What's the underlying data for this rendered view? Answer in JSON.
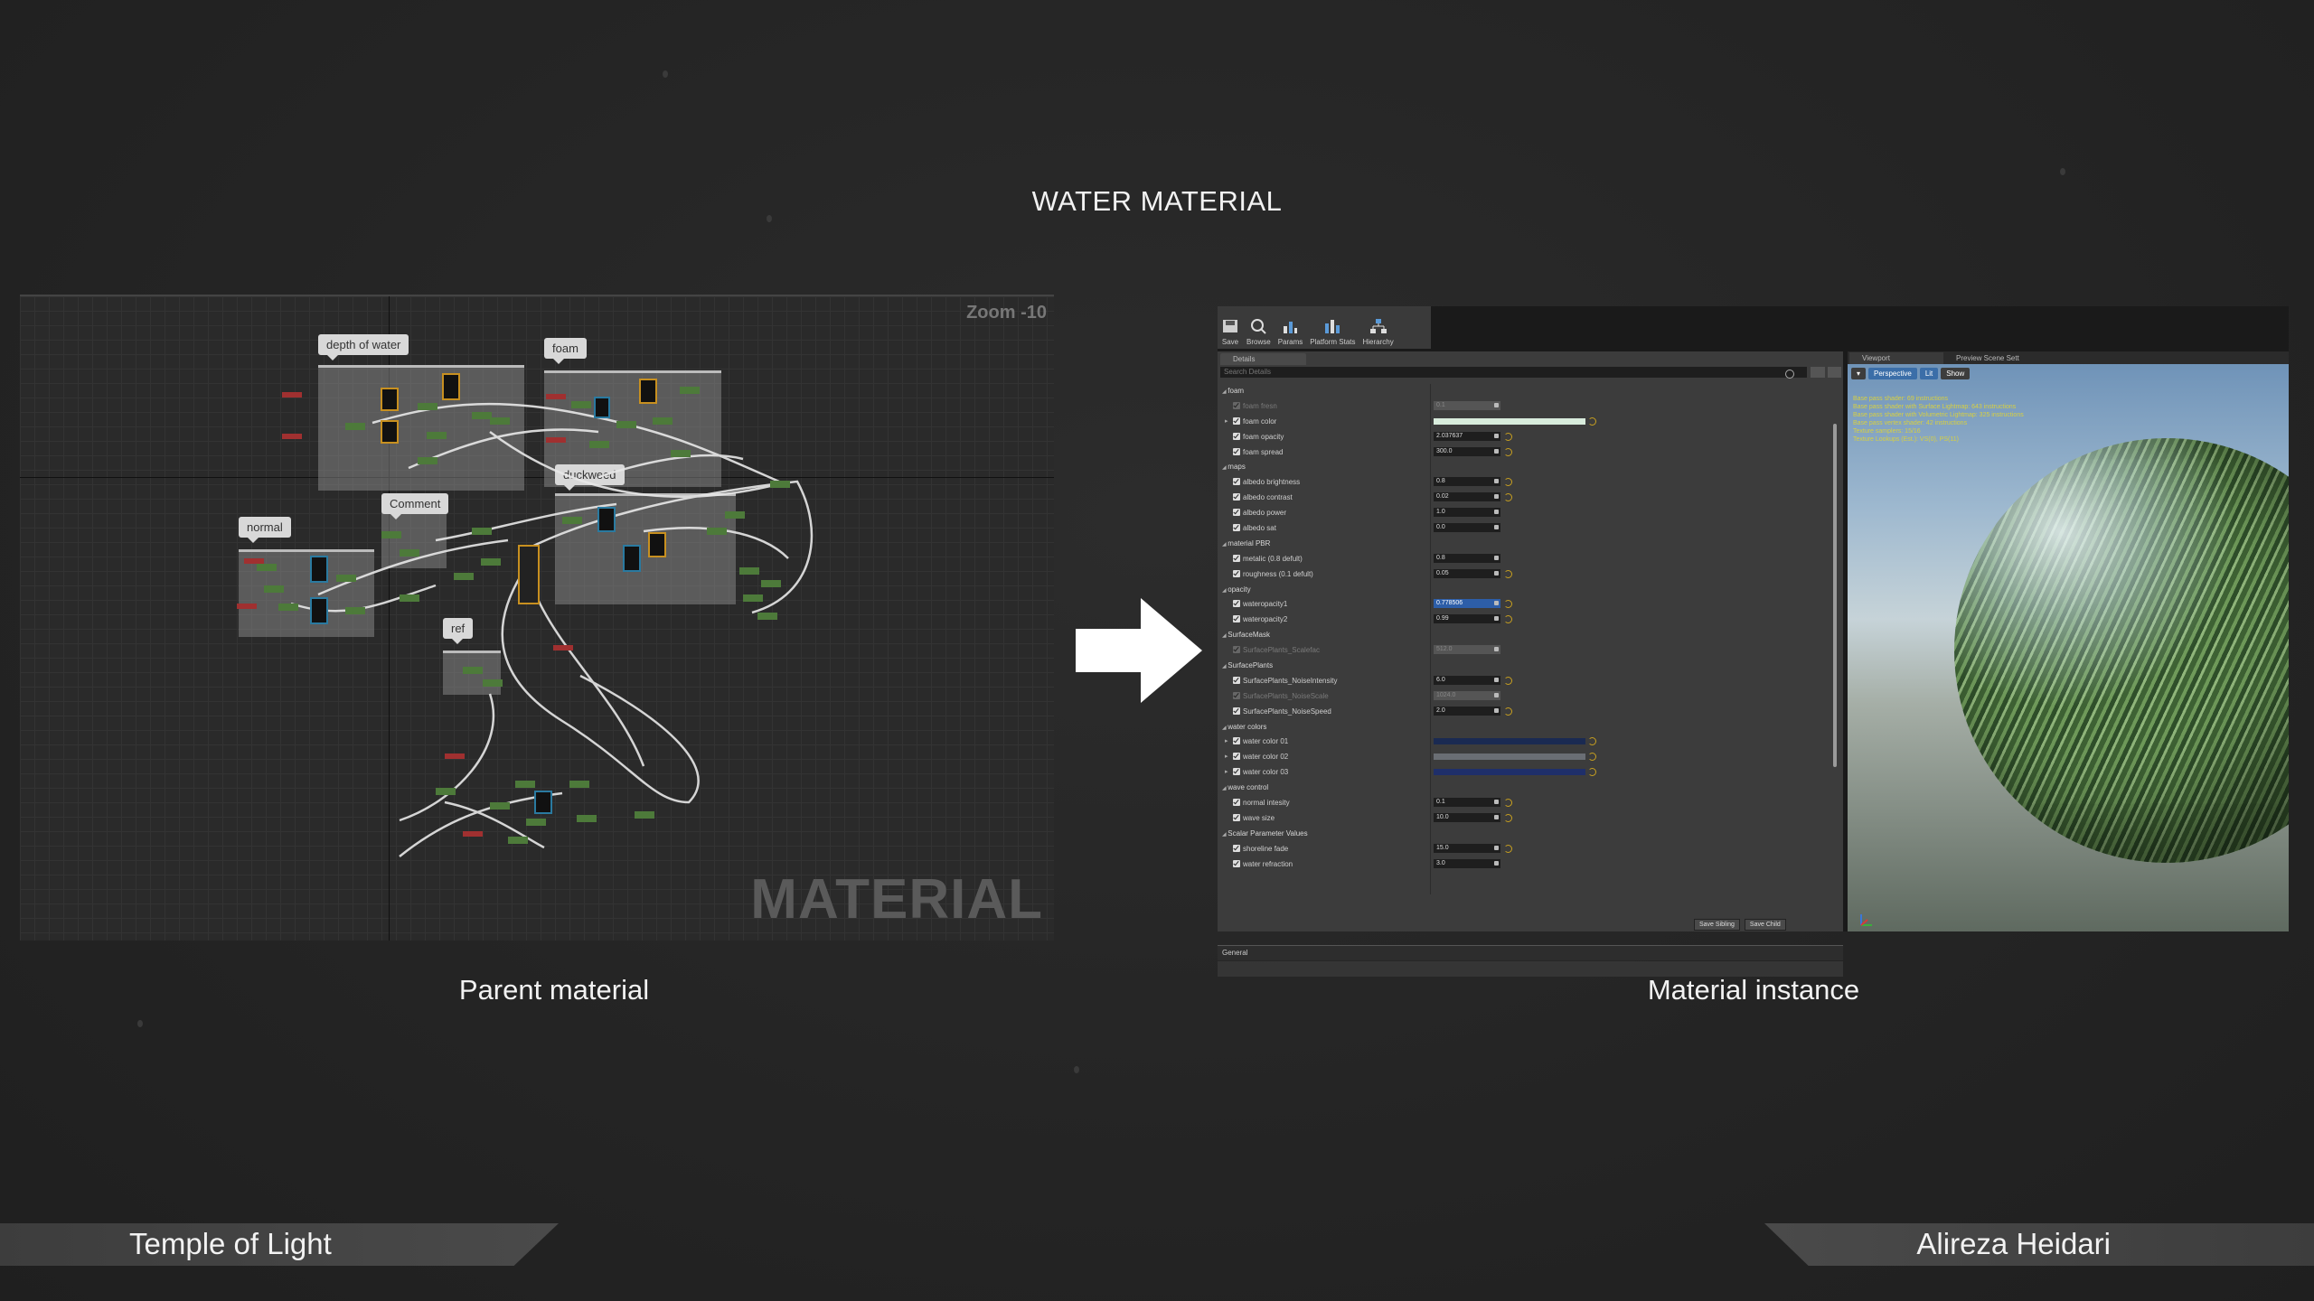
{
  "page": {
    "title": "WATER MATERIAL",
    "left_caption": "Parent material",
    "right_caption": "Material instance",
    "footer_left": "Temple of Light",
    "footer_right": "Alireza Heidari"
  },
  "graph": {
    "zoom": "Zoom -10",
    "watermark": "MATERIAL",
    "comments": [
      "depth of water",
      "foam",
      "duckweed",
      "Comment",
      "normal",
      "ref"
    ]
  },
  "editor": {
    "toolbar": [
      "Save",
      "Browse",
      "Params",
      "Platform Stats",
      "Hierarchy"
    ],
    "details_tab": "Details",
    "search_placeholder": "Search Details",
    "rows": [
      {
        "type": "cat",
        "name": "foam"
      },
      {
        "type": "param",
        "name": "foam fresn",
        "value": "0.1",
        "enabled": false
      },
      {
        "type": "param",
        "name": "foam color",
        "bar": "#d8ecdc",
        "expand": true,
        "enabled": true
      },
      {
        "type": "param",
        "name": "foam opacity",
        "value": "2.037637",
        "enabled": true,
        "reset": true
      },
      {
        "type": "param",
        "name": "foam spread",
        "value": "300.0",
        "enabled": true,
        "reset": true
      },
      {
        "type": "cat",
        "name": "maps"
      },
      {
        "type": "param",
        "name": "albedo brightness",
        "value": "0.8",
        "enabled": true,
        "reset": true
      },
      {
        "type": "param",
        "name": "albedo contrast",
        "value": "0.02",
        "enabled": true,
        "reset": true
      },
      {
        "type": "param",
        "name": "albedo power",
        "value": "1.0",
        "enabled": true
      },
      {
        "type": "param",
        "name": "albedo sat",
        "value": "0.0",
        "enabled": true
      },
      {
        "type": "cat",
        "name": "material PBR"
      },
      {
        "type": "param",
        "name": "metalic (0.8 defult)",
        "value": "0.8",
        "enabled": true
      },
      {
        "type": "param",
        "name": "roughness (0.1 defult)",
        "value": "0.05",
        "enabled": true,
        "reset": true
      },
      {
        "type": "cat",
        "name": "opacity"
      },
      {
        "type": "param",
        "name": "wateropacity1",
        "value": "0.778506",
        "enabled": true,
        "reset": true,
        "selected": true
      },
      {
        "type": "param",
        "name": "wateropacity2",
        "value": "0.99",
        "enabled": true,
        "reset": true
      },
      {
        "type": "cat",
        "name": "SurfaceMask"
      },
      {
        "type": "param",
        "name": "SurfacePlants_Scalefac",
        "value": "512.0",
        "enabled": false
      },
      {
        "type": "cat",
        "name": "SurfacePlants"
      },
      {
        "type": "param",
        "name": "SurfacePlants_NoiseIntensity",
        "value": "6.0",
        "enabled": true,
        "reset": true
      },
      {
        "type": "param",
        "name": "SurfacePlants_NoiseScale",
        "value": "1024.0",
        "enabled": false
      },
      {
        "type": "param",
        "name": "SurfacePlants_NoiseSpeed",
        "value": "2.0",
        "enabled": true,
        "reset": true
      },
      {
        "type": "cat",
        "name": "water colors"
      },
      {
        "type": "param",
        "name": "water color 01",
        "bar": "#1a2a52",
        "expand": true,
        "enabled": true
      },
      {
        "type": "param",
        "name": "water color 02",
        "bar": "#6a6e74",
        "expand": true,
        "enabled": true
      },
      {
        "type": "param",
        "name": "water color 03",
        "bar": "#1f2f6a",
        "expand": true,
        "enabled": true
      },
      {
        "type": "cat",
        "name": "wave control"
      },
      {
        "type": "param",
        "name": "normal intesity",
        "value": "0.1",
        "enabled": true,
        "reset": true
      },
      {
        "type": "param",
        "name": "wave size",
        "value": "10.0",
        "enabled": true,
        "reset": true
      },
      {
        "type": "cat",
        "name": "Scalar Parameter Values"
      },
      {
        "type": "param",
        "name": "shoreline fade",
        "value": "15.0",
        "enabled": true,
        "reset": true
      },
      {
        "type": "param",
        "name": "water refraction",
        "value": "3.0",
        "enabled": true
      }
    ],
    "save_sibling": "Save Sibling",
    "save_child": "Save Child",
    "general": "General",
    "viewport_tab": "Viewport",
    "preview_tab": "Preview Scene Sett",
    "vp_perspective": "Perspective",
    "vp_lit": "Lit",
    "vp_show": "Show",
    "stats": [
      "Base pass shader: 69 instructions",
      "Base pass shader with Surface Lightmap: 643 instructions",
      "Base pass shader with Volumetric Lightmap: 325 instructions",
      "Base pass vertex shader: 42 instructions",
      "Texture samplers: 15/16",
      "Texture Lookups (Est.): VS(0), PS(11)"
    ]
  }
}
